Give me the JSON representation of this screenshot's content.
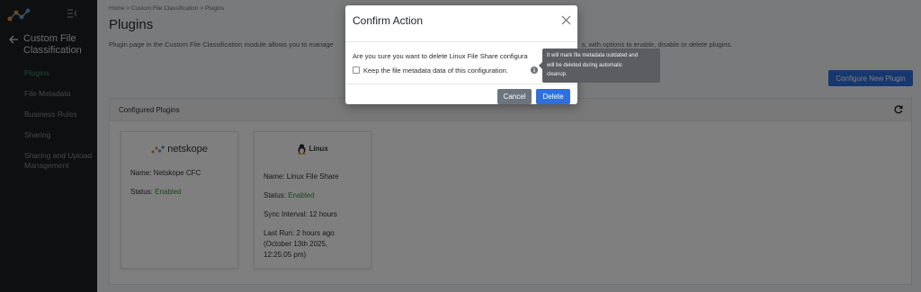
{
  "sidebar": {
    "logo_icon": "netskope-logo-icon",
    "collapse_icon": "menu-collapse-icon",
    "back_icon": "arrow-left-icon",
    "title": "Custom File Classification",
    "items": [
      {
        "label": "Plugins",
        "active": true
      },
      {
        "label": "File Metadata",
        "active": false
      },
      {
        "label": "Business Rules",
        "active": false
      },
      {
        "label": "Sharing",
        "active": false
      },
      {
        "label": "Sharing and Upload Management",
        "active": false
      }
    ]
  },
  "header": {
    "breadcrumb": "Home > Custom File Classification > Plugins",
    "title": "Plugins",
    "description": "Plugin page in the Custom File Classification module allows you to manage",
    "description_tail": "s, with options to enable, disable or delete plugins."
  },
  "configure_button": "Configure New Plugin",
  "panel": {
    "title": "Configured Plugins",
    "refresh_icon": "refresh-icon"
  },
  "cards": [
    {
      "logo_text": "netskope",
      "name_label": "Name:",
      "name": "Netskope CFC",
      "status_label": "Status:",
      "status": "Enabled"
    },
    {
      "logo_text": "Linux",
      "name_label": "Name:",
      "name": "Linux File Share",
      "status_label": "Status:",
      "status": "Enabled",
      "sync_label": "Sync Interval:",
      "sync": "12 hours",
      "last_run_label": "Last Run:",
      "last_run": "2 hours ago",
      "last_run_detail_1": "(October 13th 2025,",
      "last_run_detail_2": "12:25:05 pm)"
    }
  ],
  "modal": {
    "title": "Confirm Action",
    "message": "Are you sure you want to delete Linux File Share configura",
    "checkbox_label": "Keep the file metadata data of this configuration.",
    "checkbox_checked": false,
    "cancel_label": "Cancel",
    "delete_label": "Delete"
  },
  "tooltip": {
    "line1": "It will mark file metadata outdated and",
    "line2": "will be deleted during automatic",
    "line3": "cleanup."
  },
  "colors": {
    "primary": "#2f6fde",
    "secondary": "#6c757d",
    "active_nav": "#3f8f6a",
    "enabled": "#3a8a3a"
  }
}
